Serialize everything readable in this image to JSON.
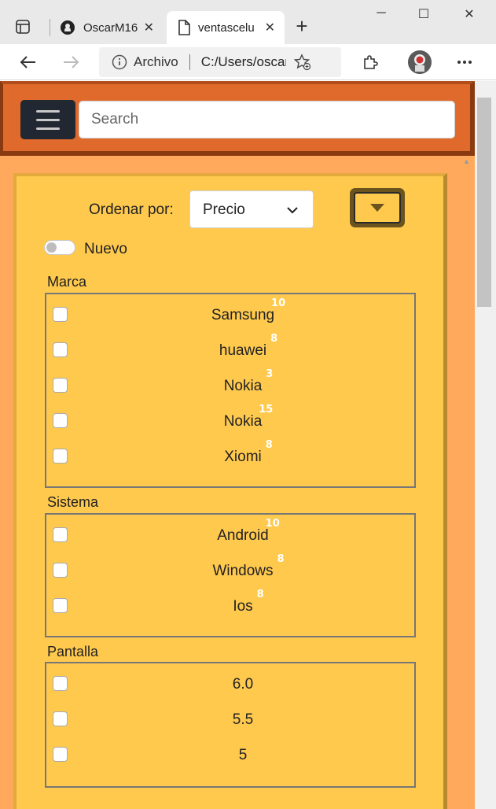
{
  "browser": {
    "tabs": [
      {
        "title": "OscarM16",
        "icon": "github-icon"
      },
      {
        "title": "ventasceluar",
        "icon": "page-icon"
      }
    ],
    "address": {
      "security_label": "Archivo",
      "url": "C:/Users/oscar/"
    }
  },
  "navbar": {
    "search_placeholder": "Search"
  },
  "filters": {
    "sort_label": "Ordenar por:",
    "sort_value": "Precio",
    "new_toggle_label": "Nuevo",
    "groups": [
      {
        "title": "Marca",
        "items": [
          {
            "label": "Samsung",
            "count": "10"
          },
          {
            "label": "huawei",
            "count": "8"
          },
          {
            "label": "Nokia",
            "count": "3"
          },
          {
            "label": "Nokia",
            "count": "15"
          },
          {
            "label": "Xiomi",
            "count": "8"
          }
        ]
      },
      {
        "title": "Sistema",
        "items": [
          {
            "label": "Android",
            "count": "10"
          },
          {
            "label": "Windows",
            "count": "8"
          },
          {
            "label": "Ios",
            "count": "8"
          }
        ]
      },
      {
        "title": "Pantalla",
        "items": [
          {
            "label": "6.0",
            "count": ""
          },
          {
            "label": "5.5",
            "count": ""
          },
          {
            "label": "5",
            "count": ""
          }
        ]
      }
    ]
  },
  "colors": {
    "navbar": "#e06a2c",
    "page_bg": "#ffa95c",
    "panel_bg": "#ffc94e",
    "toggler": "#222831"
  }
}
